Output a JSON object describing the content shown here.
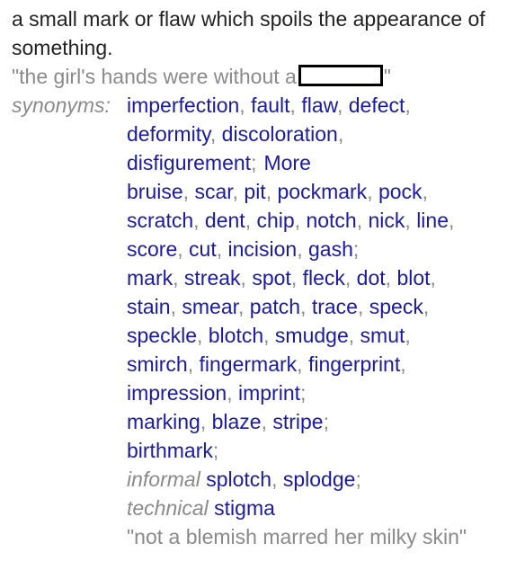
{
  "definition": "a small mark or flaw which spoils the appearance of something.",
  "example": {
    "before": "\"the girl's hands were without a",
    "after": "\""
  },
  "synonyms_label": "synonyms:",
  "more_label": "More",
  "synonym_lines": [
    {
      "register": "",
      "words": [
        "imperfection",
        "fault",
        "flaw",
        "defect"
      ],
      "end": ","
    },
    {
      "register": "",
      "words": [
        "deformity",
        "discoloration"
      ],
      "end": ","
    },
    {
      "register": "",
      "words": [
        "disfigurement"
      ],
      "end": ";",
      "more": true
    },
    {
      "register": "",
      "words": [
        "bruise",
        "scar",
        "pit",
        "pockmark",
        "pock"
      ],
      "end": ","
    },
    {
      "register": "",
      "words": [
        "scratch",
        "dent",
        "chip",
        "notch",
        "nick",
        "line"
      ],
      "end": ","
    },
    {
      "register": "",
      "words": [
        "score",
        "cut",
        "incision",
        "gash"
      ],
      "end": ";"
    },
    {
      "register": "",
      "words": [
        "mark",
        "streak",
        "spot",
        "fleck",
        "dot",
        "blot"
      ],
      "end": ","
    },
    {
      "register": "",
      "words": [
        "stain",
        "smear",
        "patch",
        "trace",
        "speck"
      ],
      "end": ","
    },
    {
      "register": "",
      "words": [
        "speckle",
        "blotch",
        "smudge",
        "smut"
      ],
      "end": ","
    },
    {
      "register": "",
      "words": [
        "smirch",
        "fingermark",
        "fingerprint"
      ],
      "end": ","
    },
    {
      "register": "",
      "words": [
        "impression",
        "imprint"
      ],
      "end": ";"
    },
    {
      "register": "",
      "words": [
        "marking",
        "blaze",
        "stripe"
      ],
      "end": ";"
    },
    {
      "register": "",
      "words": [
        "birthmark"
      ],
      "end": ";"
    },
    {
      "register": "informal",
      "words": [
        "splotch",
        "splodge"
      ],
      "end": ";"
    },
    {
      "register": "technical",
      "words": [
        "stigma"
      ],
      "end": ""
    }
  ],
  "synonym_example": "\"not a blemish marred her milky skin\"",
  "colors": {
    "text": "#222222",
    "muted": "#8a8a8a",
    "link": "#1a1aa6"
  }
}
